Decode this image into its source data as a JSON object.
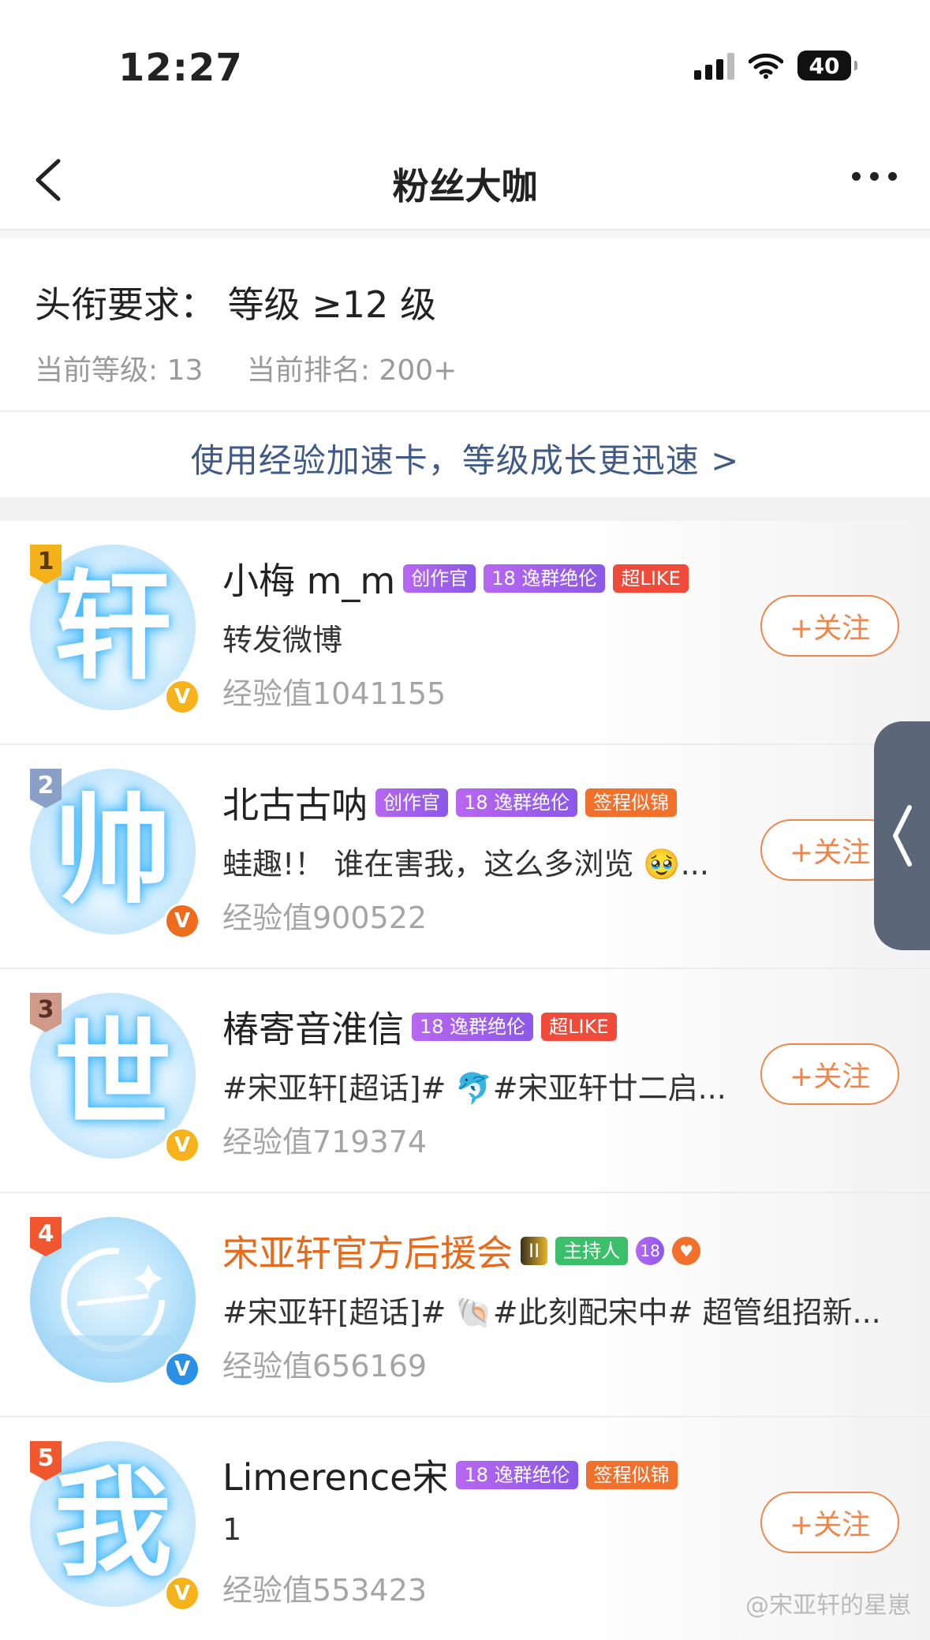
{
  "status_bar": {
    "time": "12:27",
    "battery": "40"
  },
  "nav": {
    "title": "粉丝大咖"
  },
  "requirement": {
    "title": "头衔要求：  等级 ≥12 级",
    "current_level": "当前等级: 13",
    "current_rank": "当前排名: 200+"
  },
  "boost": {
    "text": "使用经验加速卡，等级成长更迅速 >"
  },
  "fans": [
    {
      "rank": "1",
      "avatar_char": "轩",
      "name": "小梅 m_m",
      "tags": [
        "创作官",
        "18 逸群绝伦",
        "超LIKE"
      ],
      "subtitle": "转发微博",
      "exp": "经验值1041155",
      "follow": "+关注"
    },
    {
      "rank": "2",
      "avatar_char": "帅",
      "name": "北古古呐",
      "tags": [
        "创作官",
        "18 逸群绝伦",
        "签程似锦"
      ],
      "subtitle": "蛙趣!！ 谁在害我，这么多浏览 🥹...",
      "exp": "经验值900522",
      "follow": "+关注"
    },
    {
      "rank": "3",
      "avatar_char": "世",
      "name": "椿寄音淮信",
      "tags": [
        "18 逸群绝伦",
        "超LIKE"
      ],
      "subtitle": "#宋亚轩[超话]# 🐬#宋亚轩廿二启...",
      "exp": "经验值719374",
      "follow": "+关注"
    },
    {
      "rank": "4",
      "avatar_char": "",
      "name": "宋亚轩官方后援会",
      "tags": [
        "II",
        "主持人",
        "18",
        "♥"
      ],
      "subtitle": "#宋亚轩[超话]# 🐚#此刻配宋中# 超管组招新...",
      "exp": "经验值656169",
      "follow": ""
    },
    {
      "rank": "5",
      "avatar_char": "我",
      "name": "Limerence宋",
      "tags": [
        "18 逸群绝伦",
        "签程似锦"
      ],
      "subtitle": "1",
      "exp": "经验值553423",
      "follow": "+关注"
    }
  ],
  "watermark": "@宋亚轩的星崽",
  "colors": {
    "accent": "#f0854a",
    "link": "#3f5a86",
    "official_name": "#e8691a"
  }
}
